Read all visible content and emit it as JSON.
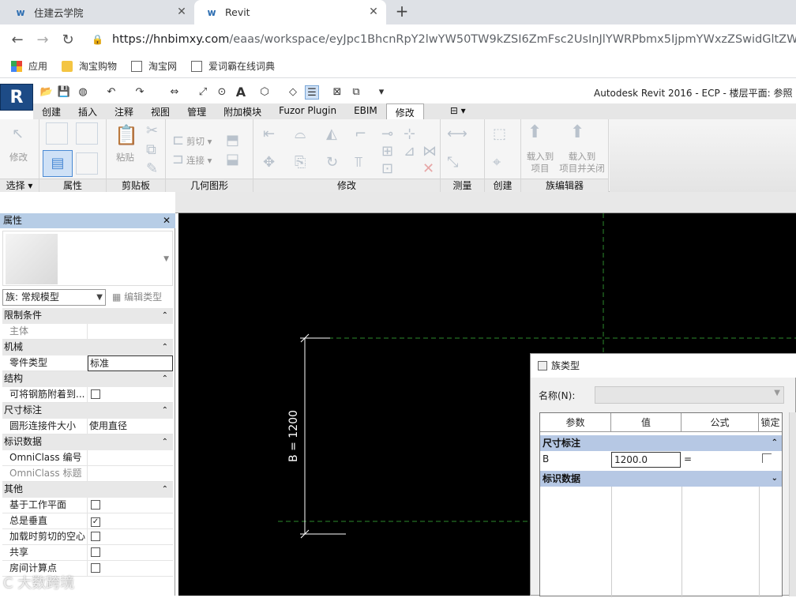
{
  "browser": {
    "tabs": [
      {
        "title": "住建云学院"
      },
      {
        "title": "Revit"
      }
    ],
    "url_host": "https://hnbimxy.com",
    "url_path": "/eaas/workspace/eyJpc1BhcnRpY2lwYW50TW9kZSI6ZmFsc2UsInJlYWRPbmx5IjpmYWxzZSwidGltZW91dCI6M",
    "bookmarks": [
      "应用",
      "淘宝购物",
      "淘宝网",
      "爱词霸在线词典"
    ]
  },
  "revit": {
    "title": "Autodesk Revit 2016 -     ECP - 楼层平面: 参照",
    "ribbon_tabs": [
      "创建",
      "插入",
      "注释",
      "视图",
      "管理",
      "附加模块",
      "Fuzor Plugin",
      "EBIM",
      "修改"
    ],
    "active_tab": "修改",
    "panels": [
      "选择",
      "属性",
      "剪贴板",
      "几何图形",
      "修改",
      "测量",
      "创建",
      "族编辑器"
    ],
    "buttons": {
      "modify": "修改",
      "paste": "粘贴",
      "cut": "剪切",
      "join": "连接",
      "load_project": "载入到\n项目",
      "load_close": "载入到\n项目并关闭"
    }
  },
  "properties": {
    "title": "属性",
    "family_selector": "族: 常规模型",
    "edit_type": "编辑类型",
    "rows": [
      {
        "type": "cat",
        "label": "限制条件"
      },
      {
        "type": "row",
        "key": "主体",
        "value": "",
        "dim": true
      },
      {
        "type": "cat",
        "label": "机械"
      },
      {
        "type": "row",
        "key": "零件类型",
        "value": "标准"
      },
      {
        "type": "cat",
        "label": "结构"
      },
      {
        "type": "row",
        "key": "可将钢筋附着到...",
        "check": false
      },
      {
        "type": "cat",
        "label": "尺寸标注"
      },
      {
        "type": "row",
        "key": "圆形连接件大小",
        "value": "使用直径"
      },
      {
        "type": "cat",
        "label": "标识数据"
      },
      {
        "type": "row",
        "key": "OmniClass 编号",
        "value": ""
      },
      {
        "type": "row",
        "key": "OmniClass 标题",
        "value": "",
        "dim": true
      },
      {
        "type": "cat",
        "label": "其他"
      },
      {
        "type": "row",
        "key": "基于工作平面",
        "check": false
      },
      {
        "type": "row",
        "key": "总是垂直",
        "check": true
      },
      {
        "type": "row",
        "key": "加载时剪切的空心",
        "check": false
      },
      {
        "type": "row",
        "key": "共享",
        "check": false
      },
      {
        "type": "row",
        "key": "房间计算点",
        "check": false
      }
    ]
  },
  "canvas": {
    "dimension_label": "B = 1200"
  },
  "dialog": {
    "title": "族类型",
    "name_label": "名称(N):",
    "columns": [
      "参数",
      "值",
      "公式",
      "锁定"
    ],
    "cat1": "尺寸标注",
    "param_name": "B",
    "param_value": "1200.0",
    "param_formula": "=",
    "cat2": "标识数据"
  },
  "watermark": "C 大数跨境"
}
